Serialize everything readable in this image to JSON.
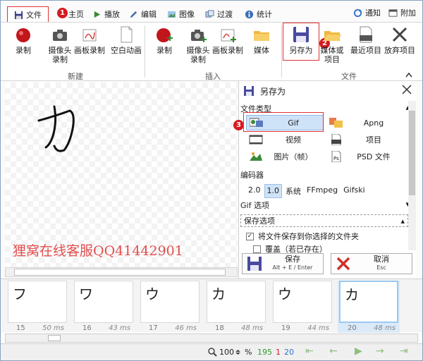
{
  "tabs": [
    {
      "label": "文件",
      "icon": "save-icon"
    },
    {
      "label": "主页",
      "icon": "home-icon"
    },
    {
      "label": "播放",
      "icon": "play-icon"
    },
    {
      "label": "编辑",
      "icon": "pencil-icon"
    },
    {
      "label": "图像",
      "icon": "image-icon"
    },
    {
      "label": "过渡",
      "icon": "transition-icon"
    },
    {
      "label": "统计",
      "icon": "info-icon"
    }
  ],
  "tab_right": {
    "notify": "通知",
    "attach": "附加"
  },
  "annotations": {
    "one": "1",
    "two": "2",
    "three": "3"
  },
  "ribbon": {
    "new_group": {
      "label": "新建",
      "buttons": [
        "录制",
        "摄像头\n录制",
        "画板录制",
        "空白动画"
      ]
    },
    "insert_group": {
      "label": "插入",
      "buttons": [
        "录制",
        "摄像头\n录制",
        "画板录制",
        "媒体"
      ]
    },
    "file_group": {
      "label": "文件",
      "buttons": [
        "另存为",
        "媒体或\n项目",
        "最近项目",
        "放弃项目"
      ]
    }
  },
  "watermark": "狸窝在线客服QQ41442901",
  "save_panel": {
    "title": "另存为",
    "file_type_label": "文件类型",
    "types": [
      "Gif",
      "Apng",
      "视频",
      "项目",
      "图片（帧）",
      "PSD 文件"
    ],
    "selected_type": "Gif",
    "encoder_label": "编码器",
    "encoders": [
      "2.0",
      "1.0",
      "系统",
      "FFmpeg",
      "Gifski"
    ],
    "selected_encoder": "1.0",
    "gif_options_label": "Gif 选项",
    "save_options_label": "保存选项",
    "save_to_folder_label": "将文件保存到你选择的文件夹",
    "save_to_folder_checked": true,
    "overwrite_label": "覆盖（若已存在）",
    "overwrite_checked": false,
    "save_button": {
      "label": "保存",
      "shortcut": "Alt + E / Enter"
    },
    "cancel_button": {
      "label": "取消",
      "shortcut": "Esc"
    }
  },
  "frames": [
    {
      "number": "15",
      "duration": "50 ms",
      "glyph": "フ"
    },
    {
      "number": "16",
      "duration": "43 ms",
      "glyph": "ワ"
    },
    {
      "number": "17",
      "duration": "46 ms",
      "glyph": "ウ"
    },
    {
      "number": "18",
      "duration": "48 ms",
      "glyph": "カ"
    },
    {
      "number": "19",
      "duration": "44 ms",
      "glyph": "ウ"
    },
    {
      "number": "20",
      "duration": "48 ms",
      "glyph": "カ"
    }
  ],
  "selected_frame": "20",
  "status": {
    "zoom": "100",
    "zoom_unit": "%",
    "total_frames": "195",
    "selected_count": "1",
    "current_frame": "20"
  },
  "colors": {
    "accent_red": "#d71920",
    "selection_blue": "#cfe3f8",
    "total_green": "#2e9a2e",
    "selected_red": "#d71920",
    "current_blue": "#2f6fd0"
  }
}
